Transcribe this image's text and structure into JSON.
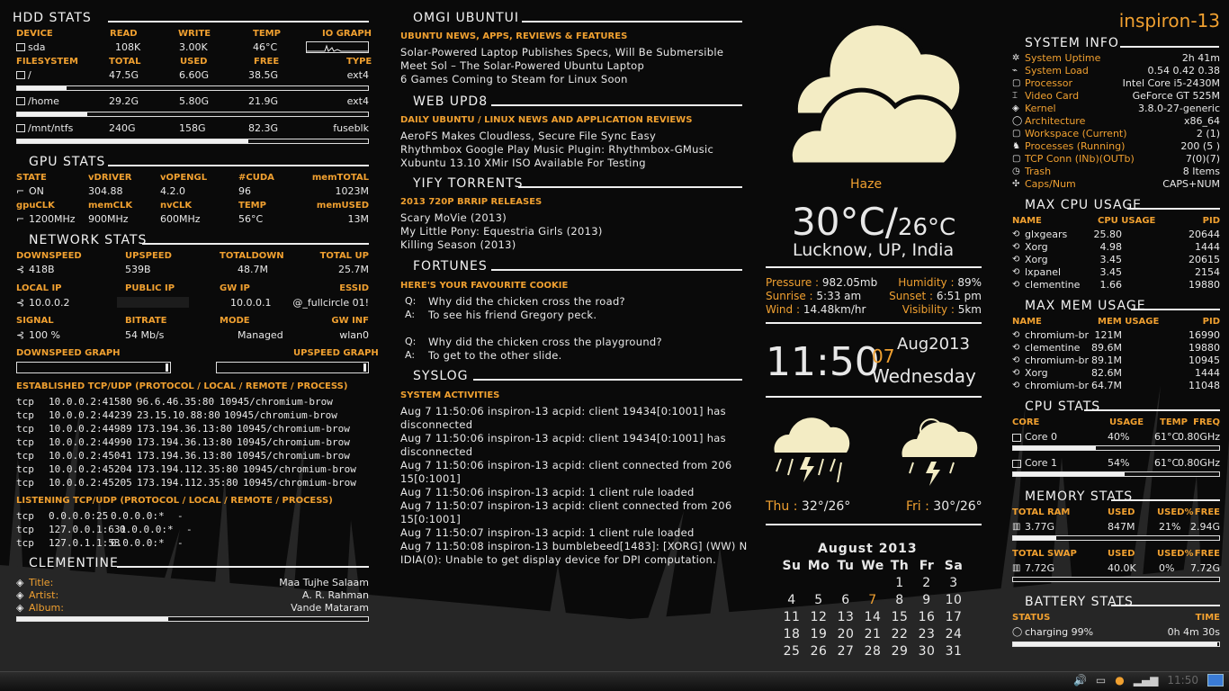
{
  "hdd": {
    "title": "HDD STATS",
    "hdr": [
      "DEVICE",
      "READ",
      "WRITE",
      "TEMP",
      "IO GRAPH"
    ],
    "dev": "sda",
    "read": "108K",
    "write": "3.00K",
    "temp": "46°C",
    "fs_hdr": [
      "FILESYSTEM",
      "TOTAL",
      "USED",
      "FREE",
      "TYPE"
    ],
    "fs": [
      {
        "name": "/",
        "total": "47.5G",
        "used": "6.60G",
        "free": "38.5G",
        "type": "ext4",
        "pct": 0.14
      },
      {
        "name": "/home",
        "total": "29.2G",
        "used": "5.80G",
        "free": "21.9G",
        "type": "ext4",
        "pct": 0.2
      },
      {
        "name": "/mnt/ntfs",
        "total": "240G",
        "used": "158G",
        "free": "82.3G",
        "type": "fuseblk",
        "pct": 0.66
      }
    ]
  },
  "gpu": {
    "title": "GPU STATS",
    "h1": [
      "STATE",
      "vDRIVER",
      "vOPENGL",
      "#CUDA",
      "memTOTAL"
    ],
    "v1": [
      "ON",
      "304.88",
      "4.2.0",
      "96",
      "1023M"
    ],
    "h2": [
      "gpuCLK",
      "memCLK",
      "nvCLK",
      "TEMP",
      "memUSED"
    ],
    "v2": [
      "1200MHz",
      "900MHz",
      "600MHz",
      "56°C",
      "13M"
    ]
  },
  "net": {
    "title": "NETWORK STATS",
    "h1": [
      "DOWNSPEED",
      "UPSPEED",
      "TOTALDOWN",
      "TOTAL UP"
    ],
    "v1": [
      "418B",
      "539B",
      "48.7M",
      "25.7M"
    ],
    "h2": [
      "LOCAL IP",
      "PUBLIC IP",
      "GW IP",
      "ESSID"
    ],
    "v2": [
      "10.0.0.2",
      "",
      "10.0.0.1",
      "@_fullcircle 01!"
    ],
    "h3": [
      "SIGNAL",
      "BITRATE",
      "MODE",
      "GW INF"
    ],
    "v3": [
      "100  %",
      "54 Mb/s",
      "Managed",
      "wlan0"
    ],
    "down_graph": "DOWNSPEED GRAPH",
    "up_graph": "UPSPEED GRAPH",
    "est_title": "ESTABLISHED TCP/UDP (PROTOCOL  / LOCAL / REMOTE / PROCESS)",
    "est": [
      [
        "tcp",
        "10.0.0.2:41580",
        "96.6.46.35:80",
        "10945/chromium-brow"
      ],
      [
        "tcp",
        "10.0.0.2:44239",
        "23.15.10.88:80",
        "10945/chromium-brow"
      ],
      [
        "tcp",
        "10.0.0.2:44989",
        "173.194.36.13:80",
        "10945/chromium-brow"
      ],
      [
        "tcp",
        "10.0.0.2:44990",
        "173.194.36.13:80",
        "10945/chromium-brow"
      ],
      [
        "tcp",
        "10.0.0.2:45041",
        "173.194.36.13:80",
        "10945/chromium-brow"
      ],
      [
        "tcp",
        "10.0.0.2:45204",
        "173.194.112.35:80",
        "10945/chromium-brow"
      ],
      [
        "tcp",
        "10.0.0.2:45205",
        "173.194.112.35:80",
        "10945/chromium-brow"
      ]
    ],
    "lis_title": "LISTENING TCP/UDP (PROTOCOL  / LOCAL / REMOTE / PROCESS)",
    "lis": [
      [
        "tcp",
        "0.0.0.0:25",
        "0.0.0.0:*",
        "-"
      ],
      [
        "tcp",
        "127.0.0.1:631",
        "0.0.0.0:*",
        "-"
      ],
      [
        "tcp",
        "127.0.1.1:53",
        "0.0.0.0:*",
        "-"
      ]
    ]
  },
  "clem": {
    "title": "CLEMENTINE",
    "labels": [
      "Title:",
      "Artist:",
      "Album:"
    ],
    "values": [
      "Maa Tujhe Salaam",
      "A. R. Rahman",
      "Vande Mataram"
    ],
    "progress": 0.43
  },
  "omg": {
    "title": "OMGI UBUNTUI",
    "sub": "UBUNTU NEWS, APPS, REVIEWS & FEATURES",
    "items": [
      "Solar-Powered Laptop Publishes Specs, Will Be Submersible",
      "Meet Sol – The Solar-Powered Ubuntu Laptop",
      "6 Games Coming to Steam for Linux Soon"
    ]
  },
  "upd8": {
    "title": "WEB UPD8",
    "sub": "DAILY UBUNTU / LINUX NEWS AND APPLICATION REVIEWS",
    "items": [
      "AeroFS Makes Cloudless, Secure File Sync Easy",
      "Rhythmbox Google Play Music Plugin: Rhythmbox-GMusic",
      "Xubuntu 13.10 XMir ISO Available For Testing"
    ]
  },
  "yify": {
    "title": "YIFY TORRENTS",
    "sub": "2013 720P BRRIP RELEASES",
    "items": [
      "Scary MoVie (2013)",
      "My Little Pony: Equestria Girls (2013)",
      "Killing Season (2013)"
    ]
  },
  "fort": {
    "title": "FORTUNES",
    "sub": "HERE'S YOUR FAVOURITE COOKIE",
    "lines": [
      [
        "Q:",
        "Why did the chicken cross the road?"
      ],
      [
        "A:",
        "To see his friend Gregory peck."
      ],
      [
        "Q:",
        "Why did the chicken cross the playground?"
      ],
      [
        "A:",
        "To get to the other slide."
      ]
    ]
  },
  "syslog": {
    "title": "SYSLOG",
    "sub": "SYSTEM ACTIVITIES",
    "lines": [
      "Aug  7 11:50:06 inspiron-13 acpid: client 19434[0:1001] has",
      "disconnected",
      "Aug  7 11:50:06 inspiron-13 acpid: client 19434[0:1001] has",
      "disconnected",
      "Aug  7 11:50:06 inspiron-13 acpid: client connected from 206",
      "15[0:1001]",
      "Aug  7 11:50:06 inspiron-13 acpid: 1 client rule loaded",
      "Aug  7 11:50:07 inspiron-13 acpid: client connected from 206",
      "15[0:1001]",
      "Aug  7 11:50:07 inspiron-13 acpid: 1 client rule loaded",
      "Aug  7 11:50:08 inspiron-13 bumblebeed[1483]: [XORG] (WW) N",
      "IDIA(0): Unable to get display device for DPI computation."
    ]
  },
  "weather": {
    "cond": "Haze",
    "temp": "30°C/",
    "low": "26°C",
    "loc": "Lucknow, UP, India",
    "l1": [
      "Pressure : ",
      "982.05mb",
      "Humidity : ",
      "89%"
    ],
    "l2": [
      "Sunrise : ",
      "5:33 am",
      "Sunset : ",
      "6:51 pm"
    ],
    "l3": [
      "Wind : ",
      "14.48km/hr",
      "Visibility : ",
      "5km"
    ],
    "thu": "Thu : ",
    "thu_t": "32°/26°",
    "fri": "Fri : ",
    "fri_t": "30°/26°"
  },
  "clock": {
    "time": "11:50",
    "day": "07",
    "monthyear": "Aug2013",
    "weekday": "Wednesday"
  },
  "cal": {
    "title": "August  2013",
    "days": [
      "Su",
      "Mo",
      "Tu",
      "We",
      "Th",
      "Fr",
      "Sa"
    ],
    "weeks": [
      [
        "",
        "",
        "",
        "",
        "1",
        "2",
        "3"
      ],
      [
        "4",
        "5",
        "6",
        "7",
        "8",
        "9",
        "10"
      ],
      [
        "11",
        "12",
        "13",
        "14",
        "15",
        "16",
        "17"
      ],
      [
        "18",
        "19",
        "20",
        "21",
        "22",
        "23",
        "24"
      ],
      [
        "25",
        "26",
        "27",
        "28",
        "29",
        "30",
        "31"
      ]
    ],
    "today": "7"
  },
  "sys": {
    "host": "inspiron-13",
    "title": "SYSTEM INFO",
    "rows": [
      [
        "System Uptime",
        "2h 41m"
      ],
      [
        "System Load",
        "0.54 0.42 0.38"
      ],
      [
        "Processor",
        "Intel Core i5-2430M"
      ],
      [
        "Video Card",
        "GeForce GT 525M"
      ],
      [
        "Kernel",
        "3.8.0-27-generic"
      ],
      [
        "Architecture",
        "x86_64"
      ],
      [
        "Workspace (Current)",
        "2 (1)"
      ],
      [
        "Processes (Running)",
        "200  (5   )"
      ],
      [
        "TCP Conn (INb)(OUTb)",
        "7(0)(7)"
      ],
      [
        "Trash",
        "8 Items"
      ],
      [
        "Caps/Num",
        "CAPS+NUM"
      ]
    ]
  },
  "cpu": {
    "title": "MAX CPU USAGE",
    "hdr": [
      "NAME",
      "CPU USAGE",
      "PID"
    ],
    "rows": [
      [
        "glxgears",
        "25.80",
        "20644"
      ],
      [
        "Xorg",
        "4.98",
        "1444"
      ],
      [
        "Xorg",
        "3.45",
        "20615"
      ],
      [
        "lxpanel",
        "3.45",
        "2154"
      ],
      [
        "clementine",
        "1.66",
        "19880"
      ]
    ]
  },
  "mem": {
    "title": "MAX MEM USAGE",
    "hdr": [
      "NAME",
      "MEM USAGE",
      "PID"
    ],
    "rows": [
      [
        "chromium-br",
        "121M",
        "16990"
      ],
      [
        "clementine",
        "89.6M",
        "19880"
      ],
      [
        "chromium-br",
        "89.1M",
        "10945"
      ],
      [
        "Xorg",
        "82.6M",
        "1444"
      ],
      [
        "chromium-br",
        "64.7M",
        "11048"
      ]
    ]
  },
  "cpustats": {
    "title": "CPU STATS",
    "hdr": [
      "CORE",
      "USAGE",
      "TEMP",
      "FREQ"
    ],
    "rows": [
      [
        "Core 0",
        "40%",
        "61°C",
        "0.80GHz",
        0.4
      ],
      [
        "Core 1",
        "54%",
        "61°C",
        "0.80GHz",
        0.54
      ]
    ]
  },
  "memstats": {
    "title": "MEMORY STATS",
    "h1": [
      "TOTAL RAM",
      "USED",
      "USED%",
      "FREE"
    ],
    "v1": [
      "3.77G",
      "847M",
      "21%",
      "2.94G"
    ],
    "ram_pct": 0.21,
    "h2": [
      "TOTAL SWAP",
      "USED",
      "USED%",
      "FREE"
    ],
    "v2": [
      "7.72G",
      "40.0K",
      "0%",
      "7.72G"
    ],
    "swap_pct": 0.0
  },
  "bat": {
    "title": "BATTERY STATS",
    "hdr": [
      "STATUS",
      "TIME"
    ],
    "status": "charging 99%",
    "time": "0h 4m 30s",
    "pct": 0.99
  },
  "tray": {
    "time": "11:50"
  }
}
